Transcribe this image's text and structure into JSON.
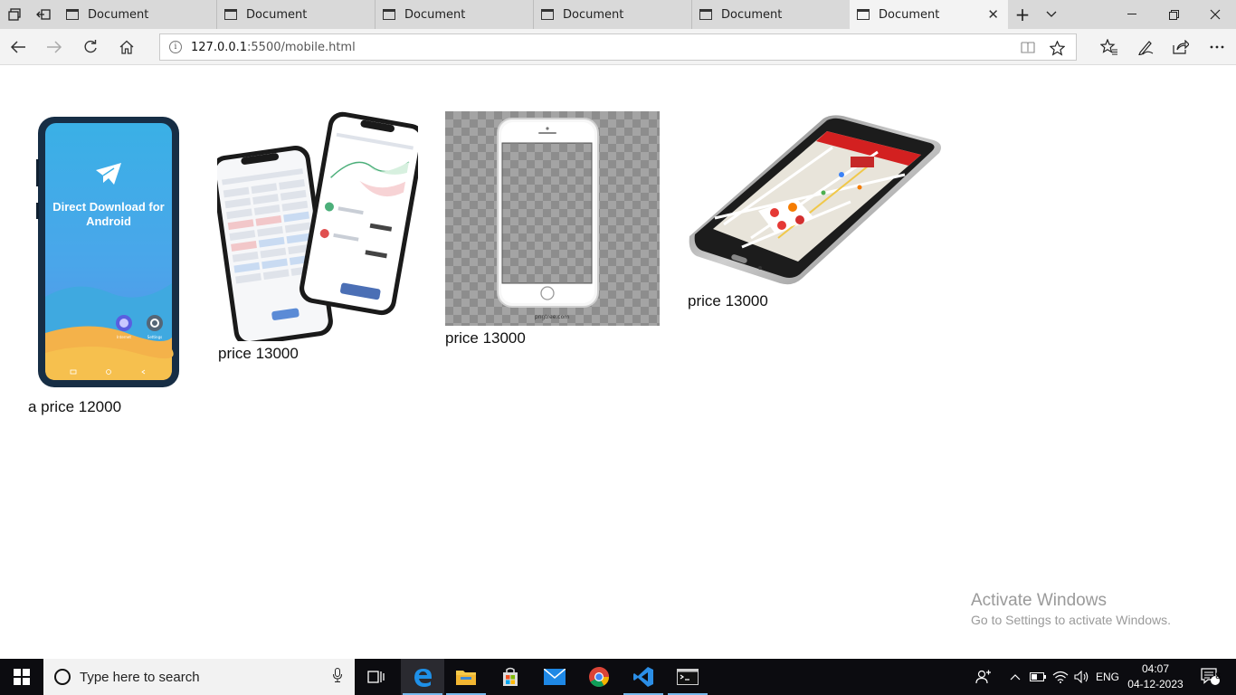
{
  "browser": {
    "tabs": [
      {
        "title": "Document",
        "active": false
      },
      {
        "title": "Document",
        "active": false
      },
      {
        "title": "Document",
        "active": false
      },
      {
        "title": "Document",
        "active": false
      },
      {
        "title": "Document",
        "active": false
      },
      {
        "title": "Document",
        "active": true
      }
    ],
    "address": {
      "host": "127.0.0.1",
      "path": ":5500/mobile.html"
    }
  },
  "products": [
    {
      "caption": "a price 12000",
      "screen_text": "Direct Download for Android",
      "icon_labels": [
        "Internet",
        "Settings"
      ]
    },
    {
      "caption": "price 13000"
    },
    {
      "caption": "price 13000",
      "image_credit": "pngtree.com"
    },
    {
      "caption": "price 13000"
    }
  ],
  "watermark": {
    "title": "Activate Windows",
    "subtitle": "Go to Settings to activate Windows."
  },
  "taskbar": {
    "search_placeholder": "Type here to search",
    "language": "ENG",
    "time": "04:07",
    "date": "04-12-2023",
    "notification_count": "8"
  },
  "colors": {
    "accent": "#0078d7",
    "taskbar": "#0c0c10"
  }
}
